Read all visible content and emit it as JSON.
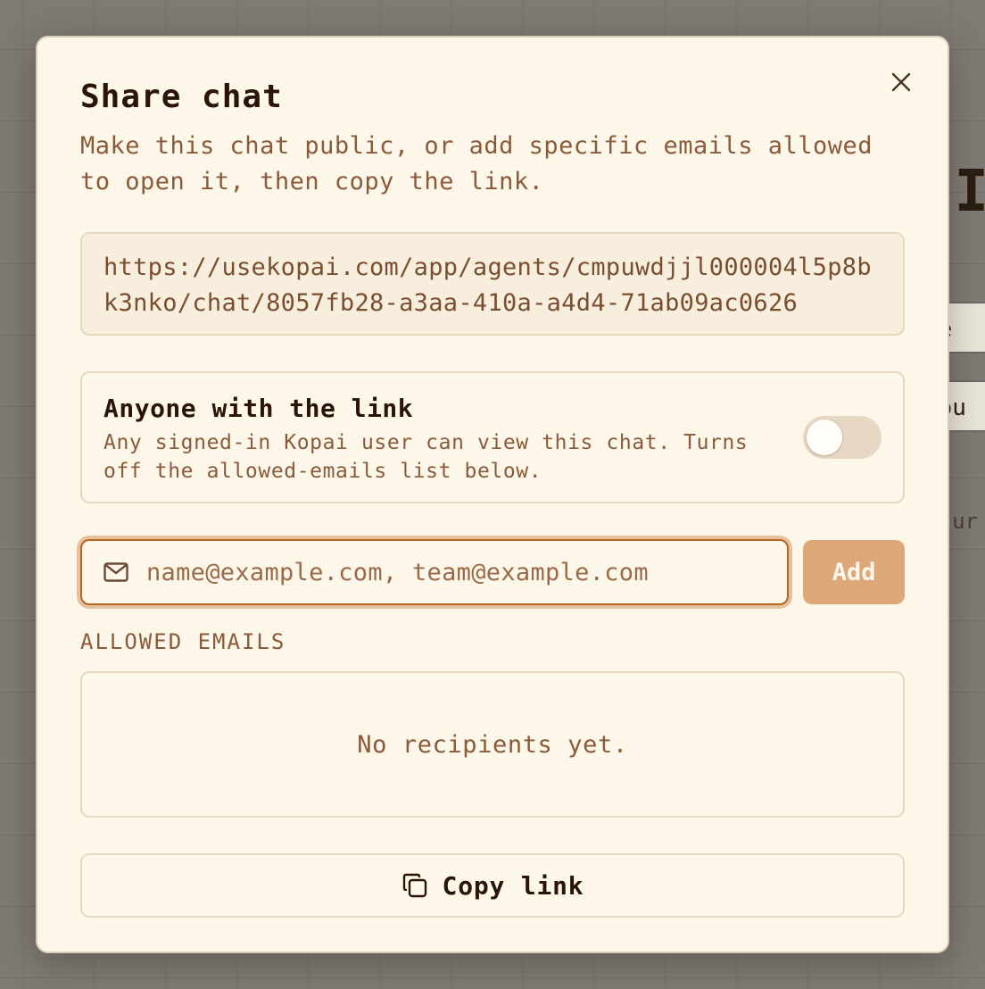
{
  "background": {
    "heading_fragment": "NI",
    "pill_1": "te",
    "pill_2": "hou",
    "hint": "ur"
  },
  "dialog": {
    "title": "Share chat",
    "description": "Make this chat public, or add specific emails allowed to open it, then copy the link.",
    "close_icon": "close-icon",
    "share_url": "https://usekopai.com/app/agents/cmpuwdjjl000004l5p8bk3nko/chat/8057fb28-a3aa-410a-a4d4-71ab09ac0626",
    "public": {
      "title": "Anyone with the link",
      "description": "Any signed-in Kopai user can view this chat. Turns off the allowed-emails list below.",
      "enabled": false
    },
    "email_input": {
      "icon": "mail-icon",
      "placeholder": "name@example.com, team@example.com",
      "value": ""
    },
    "add_label": "Add",
    "allowed_section_label": "ALLOWED EMAILS",
    "empty_recipients": "No recipients yet.",
    "copy_icon": "copy-icon",
    "copy_label": "Copy link"
  },
  "colors": {
    "accent": "#b8661f",
    "add_button": "#dda777",
    "dialog_bg": "#fcf7e8",
    "muted_text": "#8a5a3a"
  }
}
